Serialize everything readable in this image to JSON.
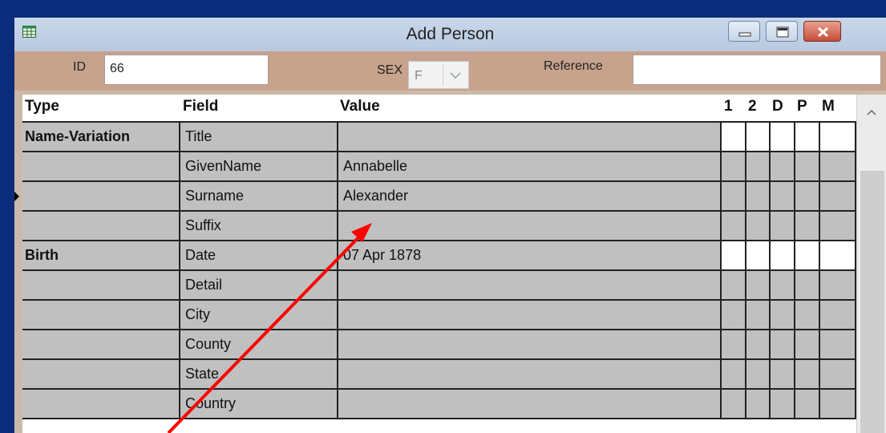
{
  "window": {
    "title": "Add Person"
  },
  "titlebar_controls": {
    "minimize_icon": "minimize-icon",
    "maximize_icon": "maximize-icon",
    "close_icon": "close-icon"
  },
  "header": {
    "id_label": "ID",
    "id_value": "66",
    "sex_label": "SEX",
    "sex_value": "F",
    "reference_label": "Reference",
    "reference_value": ""
  },
  "grid": {
    "columns": {
      "type": "Type",
      "field": "Field",
      "value": "Value",
      "flags": [
        "1",
        "2",
        "D",
        "P",
        "M"
      ]
    },
    "rows": [
      {
        "type": "Name-Variation",
        "field": "Title",
        "value": "",
        "flags_white": true,
        "selected": false
      },
      {
        "type": "",
        "field": "GivenName",
        "value": "Annabelle",
        "flags_white": false,
        "selected": false
      },
      {
        "type": "",
        "field": "Surname",
        "value": "Alexander",
        "flags_white": false,
        "selected": true
      },
      {
        "type": "",
        "field": "Suffix",
        "value": "",
        "flags_white": false,
        "selected": false
      },
      {
        "type": "Birth",
        "field": "Date",
        "value": "07 Apr 1878",
        "flags_white": true,
        "selected": false
      },
      {
        "type": "",
        "field": "Detail",
        "value": "",
        "flags_white": false,
        "selected": false
      },
      {
        "type": "",
        "field": "City",
        "value": "",
        "flags_white": false,
        "selected": false
      },
      {
        "type": "",
        "field": "County",
        "value": "",
        "flags_white": false,
        "selected": false
      },
      {
        "type": "",
        "field": "State",
        "value": "",
        "flags_white": false,
        "selected": false
      },
      {
        "type": "",
        "field": "Country",
        "value": "",
        "flags_white": false,
        "selected": false
      }
    ]
  },
  "annotation": {
    "color": "#ff0000",
    "kind": "red-arrow"
  },
  "colors": {
    "desktop": "#0b2c7a",
    "header_band": "#c7a28c",
    "cell_gray": "#c0c0c0"
  }
}
